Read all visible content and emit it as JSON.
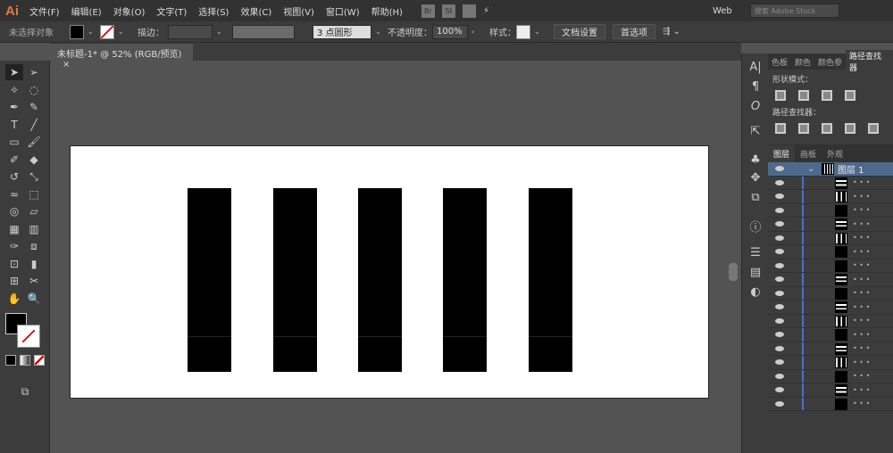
{
  "app": {
    "logo": "Ai"
  },
  "menu": [
    "文件(F)",
    "编辑(E)",
    "对象(O)",
    "文字(T)",
    "选择(S)",
    "效果(C)",
    "视图(V)",
    "窗口(W)",
    "帮助(H)"
  ],
  "menu_right": {
    "br": "Br",
    "st": "St",
    "workspace": "Web",
    "search_placeholder": "搜索 Adobe Stock"
  },
  "control": {
    "selection": "未选择对象",
    "stroke_label": "描边：",
    "brush": "3 点圆形",
    "opacity_label": "不透明度：",
    "opacity": "100%",
    "style_label": "样式：",
    "doc_setup": "文档设置",
    "prefs": "首选项"
  },
  "document": {
    "tab": "未标题-1* @ 52% (RGB/预览)",
    "close": "×"
  },
  "panels": {
    "tabs": [
      "色板",
      "颜色",
      "颜色参",
      "路径查找器"
    ],
    "shape_modes": "形状模式：",
    "pathfinder": "路径查找器：",
    "layer_tabs": [
      "图层",
      "画板",
      "外观"
    ],
    "layer_name": "图层 1"
  },
  "layer_rows": [
    "h",
    "v",
    "b",
    "h",
    "v",
    "b",
    "b",
    "h",
    "b",
    "h",
    "v",
    "b",
    "h",
    "v",
    "b",
    "h",
    "b"
  ],
  "colors": {
    "accent": "#4a6fd8",
    "fill": "#000000"
  }
}
